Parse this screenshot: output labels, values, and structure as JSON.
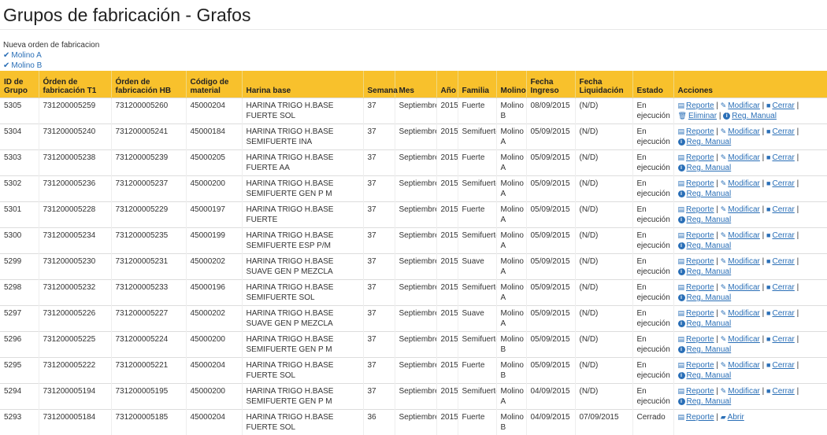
{
  "page": {
    "title": "Grupos de fabricación - Grafos"
  },
  "links": {
    "new_order": "Nueva orden de fabricacion",
    "molino_a": "Molino A",
    "molino_b": "Molino B"
  },
  "table": {
    "headers": [
      "ID de Grupo",
      "Órden de fabricación T1",
      "Órden de fabricación HB",
      "Código de material",
      "Harina base",
      "Semana",
      "Mes",
      "Año",
      "Familia",
      "Molino",
      "Fecha Ingreso",
      "Fecha Liquidación",
      "Estado",
      "Acciones"
    ],
    "action_labels": {
      "reporte": "Reporte",
      "modificar": "Modificar",
      "cerrar": "Cerrar",
      "eliminar": "Eliminar",
      "reg_manual": "Reg. Manual",
      "abrir": "Abrir"
    },
    "rows": [
      {
        "id": "5305",
        "t1": "731200005259",
        "hb": "731200005260",
        "code": "45000204",
        "harina": "HARINA TRIGO H.BASE FUERTE SOL",
        "semana": "37",
        "mes": "Septiembre",
        "anio": "2015",
        "familia": "Fuerte",
        "molino": "Molino B",
        "ingreso": "08/09/2015",
        "liquidacion": "(N/D)",
        "estado": "En ejecución"
      },
      {
        "id": "5304",
        "t1": "731200005240",
        "hb": "731200005241",
        "code": "45000184",
        "harina": "HARINA TRIGO H.BASE SEMIFUERTE INA",
        "semana": "37",
        "mes": "Septiembre",
        "anio": "2015",
        "familia": "Semifuerte",
        "molino": "Molino A",
        "ingreso": "05/09/2015",
        "liquidacion": "(N/D)",
        "estado": "En ejecución"
      },
      {
        "id": "5303",
        "t1": "731200005238",
        "hb": "731200005239",
        "code": "45000205",
        "harina": "HARINA TRIGO H.BASE FUERTE AA",
        "semana": "37",
        "mes": "Septiembre",
        "anio": "2015",
        "familia": "Fuerte",
        "molino": "Molino A",
        "ingreso": "05/09/2015",
        "liquidacion": "(N/D)",
        "estado": "En ejecución"
      },
      {
        "id": "5302",
        "t1": "731200005236",
        "hb": "731200005237",
        "code": "45000200",
        "harina": "HARINA TRIGO H.BASE SEMIFUERTE GEN P M",
        "semana": "37",
        "mes": "Septiembre",
        "anio": "2015",
        "familia": "Semifuerte",
        "molino": "Molino A",
        "ingreso": "05/09/2015",
        "liquidacion": "(N/D)",
        "estado": "En ejecución"
      },
      {
        "id": "5301",
        "t1": "731200005228",
        "hb": "731200005229",
        "code": "45000197",
        "harina": "HARINA TRIGO H.BASE FUERTE",
        "semana": "37",
        "mes": "Septiembre",
        "anio": "2015",
        "familia": "Fuerte",
        "molino": "Molino A",
        "ingreso": "05/09/2015",
        "liquidacion": "(N/D)",
        "estado": "En ejecución"
      },
      {
        "id": "5300",
        "t1": "731200005234",
        "hb": "731200005235",
        "code": "45000199",
        "harina": "HARINA TRIGO H.BASE SEMIFUERTE ESP P/M",
        "semana": "37",
        "mes": "Septiembre",
        "anio": "2015",
        "familia": "Semifuerte",
        "molino": "Molino A",
        "ingreso": "05/09/2015",
        "liquidacion": "(N/D)",
        "estado": "En ejecución"
      },
      {
        "id": "5299",
        "t1": "731200005230",
        "hb": "731200005231",
        "code": "45000202",
        "harina": "HARINA TRIGO H.BASE SUAVE GEN P MEZCLA",
        "semana": "37",
        "mes": "Septiembre",
        "anio": "2015",
        "familia": "Suave",
        "molino": "Molino A",
        "ingreso": "05/09/2015",
        "liquidacion": "(N/D)",
        "estado": "En ejecución"
      },
      {
        "id": "5298",
        "t1": "731200005232",
        "hb": "731200005233",
        "code": "45000196",
        "harina": "HARINA TRIGO H.BASE SEMIFUERTE SOL",
        "semana": "37",
        "mes": "Septiembre",
        "anio": "2015",
        "familia": "Semifuerte",
        "molino": "Molino A",
        "ingreso": "05/09/2015",
        "liquidacion": "(N/D)",
        "estado": "En ejecución"
      },
      {
        "id": "5297",
        "t1": "731200005226",
        "hb": "731200005227",
        "code": "45000202",
        "harina": "HARINA TRIGO H.BASE SUAVE GEN P MEZCLA",
        "semana": "37",
        "mes": "Septiembre",
        "anio": "2015",
        "familia": "Suave",
        "molino": "Molino A",
        "ingreso": "05/09/2015",
        "liquidacion": "(N/D)",
        "estado": "En ejecución"
      },
      {
        "id": "5296",
        "t1": "731200005225",
        "hb": "731200005224",
        "code": "45000200",
        "harina": "HARINA TRIGO H.BASE SEMIFUERTE GEN P M",
        "semana": "37",
        "mes": "Septiembre",
        "anio": "2015",
        "familia": "Semifuerte",
        "molino": "Molino B",
        "ingreso": "05/09/2015",
        "liquidacion": "(N/D)",
        "estado": "En ejecución"
      },
      {
        "id": "5295",
        "t1": "731200005222",
        "hb": "731200005221",
        "code": "45000204",
        "harina": "HARINA TRIGO H.BASE FUERTE SOL",
        "semana": "37",
        "mes": "Septiembre",
        "anio": "2015",
        "familia": "Fuerte",
        "molino": "Molino B",
        "ingreso": "05/09/2015",
        "liquidacion": "(N/D)",
        "estado": "En ejecución"
      },
      {
        "id": "5294",
        "t1": "731200005194",
        "hb": "731200005195",
        "code": "45000200",
        "harina": "HARINA TRIGO H.BASE SEMIFUERTE GEN P M",
        "semana": "37",
        "mes": "Septiembre",
        "anio": "2015",
        "familia": "Semifuerte",
        "molino": "Molino A",
        "ingreso": "04/09/2015",
        "liquidacion": "(N/D)",
        "estado": "En ejecución"
      },
      {
        "id": "5293",
        "t1": "731200005184",
        "hb": "731200005185",
        "code": "45000204",
        "harina": "HARINA TRIGO H.BASE FUERTE SOL",
        "semana": "36",
        "mes": "Septiembre",
        "anio": "2015",
        "familia": "Fuerte",
        "molino": "Molino B",
        "ingreso": "04/09/2015",
        "liquidacion": "07/09/2015",
        "estado": "Cerrado"
      }
    ]
  }
}
